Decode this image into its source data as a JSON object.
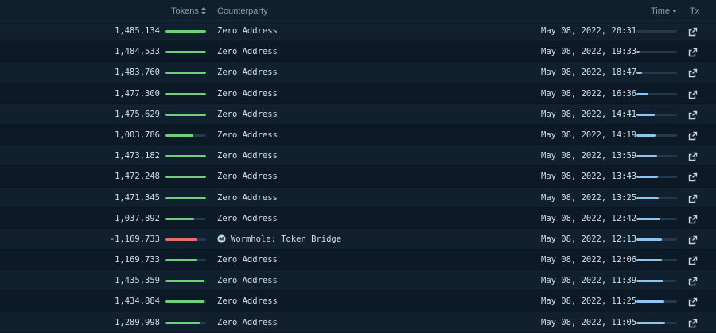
{
  "header": {
    "tokens": "Tokens",
    "counterparty": "Counterparty",
    "time": "Time",
    "tx": "Tx"
  },
  "colors": {
    "positive": "#6fcf7a",
    "negative": "#e36f6f",
    "time_bar": "#8fc6f0"
  },
  "rows": [
    {
      "amount": "1,485,134",
      "token_fill": 1.0,
      "counterparty": "Zero Address",
      "time": "May 08, 2022, 20:31",
      "time_fill": 0.0,
      "negative": false
    },
    {
      "amount": "1,484,533",
      "token_fill": 1.0,
      "counterparty": "Zero Address",
      "time": "May 08, 2022, 19:33",
      "time_fill": 0.07,
      "negative": false
    },
    {
      "amount": "1,483,760",
      "token_fill": 1.0,
      "counterparty": "Zero Address",
      "time": "May 08, 2022, 18:47",
      "time_fill": 0.13,
      "negative": false
    },
    {
      "amount": "1,477,300",
      "token_fill": 1.0,
      "counterparty": "Zero Address",
      "time": "May 08, 2022, 16:36",
      "time_fill": 0.3,
      "negative": false
    },
    {
      "amount": "1,475,629",
      "token_fill": 1.0,
      "counterparty": "Zero Address",
      "time": "May 08, 2022, 14:41",
      "time_fill": 0.45,
      "negative": false
    },
    {
      "amount": "1,003,786",
      "token_fill": 0.68,
      "counterparty": "Zero Address",
      "time": "May 08, 2022, 14:19",
      "time_fill": 0.47,
      "negative": false
    },
    {
      "amount": "1,473,182",
      "token_fill": 1.0,
      "counterparty": "Zero Address",
      "time": "May 08, 2022, 13:59",
      "time_fill": 0.5,
      "negative": false
    },
    {
      "amount": "1,472,248",
      "token_fill": 1.0,
      "counterparty": "Zero Address",
      "time": "May 08, 2022, 13:43",
      "time_fill": 0.52,
      "negative": false
    },
    {
      "amount": "1,471,345",
      "token_fill": 1.0,
      "counterparty": "Zero Address",
      "time": "May 08, 2022, 13:25",
      "time_fill": 0.54,
      "negative": false
    },
    {
      "amount": "1,037,892",
      "token_fill": 0.7,
      "counterparty": "Zero Address",
      "time": "May 08, 2022, 12:42",
      "time_fill": 0.59,
      "negative": false
    },
    {
      "amount": "-1,169,733",
      "token_fill": 0.79,
      "counterparty": "Wormhole: Token Bridge",
      "time": "May 08, 2022, 12:13",
      "time_fill": 0.62,
      "negative": true,
      "has_icon": true
    },
    {
      "amount": "1,169,733",
      "token_fill": 0.79,
      "counterparty": "Zero Address",
      "time": "May 08, 2022, 12:06",
      "time_fill": 0.63,
      "negative": false
    },
    {
      "amount": "1,435,359",
      "token_fill": 0.97,
      "counterparty": "Zero Address",
      "time": "May 08, 2022, 11:39",
      "time_fill": 0.66,
      "negative": false
    },
    {
      "amount": "1,434,884",
      "token_fill": 0.97,
      "counterparty": "Zero Address",
      "time": "May 08, 2022, 11:25",
      "time_fill": 0.68,
      "negative": false
    },
    {
      "amount": "1,289,998",
      "token_fill": 0.87,
      "counterparty": "Zero Address",
      "time": "May 08, 2022, 11:05",
      "time_fill": 0.71,
      "negative": false
    }
  ]
}
